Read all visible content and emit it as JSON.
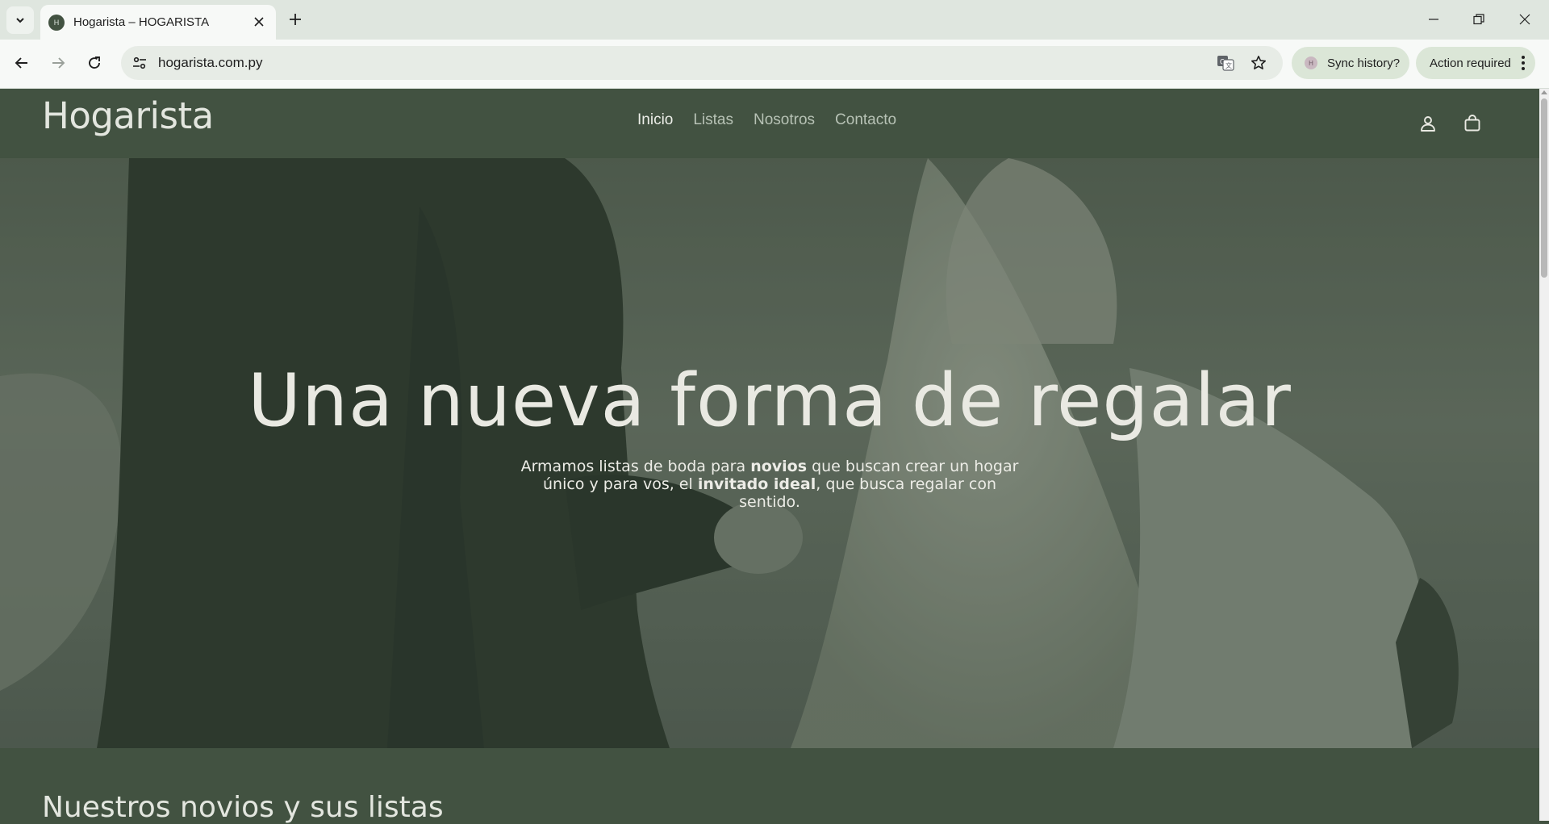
{
  "browser": {
    "tab_title": "Hogarista – HOGARISTA",
    "favicon_text": "H",
    "url": "hogarista.com.py",
    "sync_chip": "Sync history?",
    "action_chip": "Action required"
  },
  "site": {
    "logo": "Hogarista",
    "nav": [
      "Inicio",
      "Listas",
      "Nosotros",
      "Contacto"
    ],
    "active_nav": "Inicio"
  },
  "hero": {
    "title": "Una nueva forma de regalar",
    "subtitle_parts": [
      "Armamos listas de boda para ",
      "novios",
      " que buscan crear un hogar único y para vos, el ",
      "invitado ideal",
      ", que busca regalar con sentido."
    ]
  },
  "section": {
    "title": "Nuestros novios y sus listas"
  },
  "colors": {
    "brand_green": "#425241",
    "cream": "#e9e9e2"
  }
}
